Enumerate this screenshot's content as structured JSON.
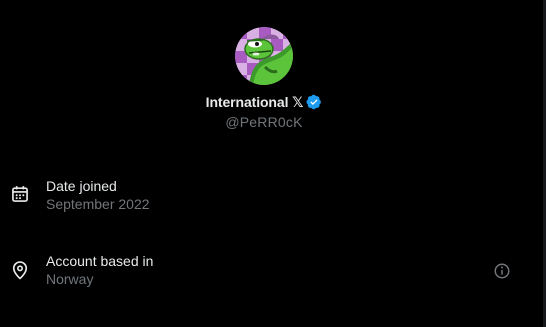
{
  "profile": {
    "display_name": "International 𝕏",
    "handle": "@PeRR0cK"
  },
  "about": {
    "date_joined_label": "Date joined",
    "date_joined_value": "September 2022",
    "location_label": "Account based in",
    "location_value": "Norway"
  },
  "icons": {
    "calendar": "calendar-icon",
    "location": "location-pin-icon",
    "info": "info-icon",
    "verified": "verified-badge-icon"
  },
  "colors": {
    "background": "#000000",
    "primary_text": "#e7e9ea",
    "secondary_text": "#71767b",
    "verified_blue": "#1d9bf0"
  }
}
